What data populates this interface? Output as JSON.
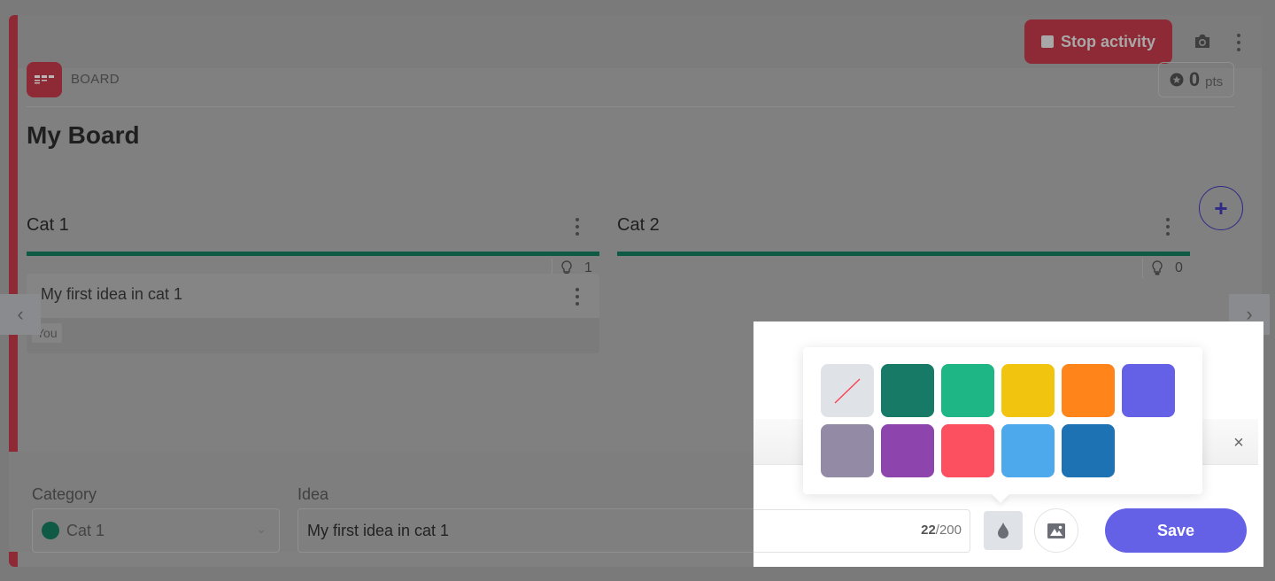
{
  "header": {
    "stop_label": "Stop activity",
    "points_value": "0",
    "points_unit": "pts"
  },
  "board": {
    "type_label": "BOARD",
    "title": "My Board"
  },
  "columns": [
    {
      "title": "Cat 1",
      "count": "1",
      "color": "#0f5a44"
    },
    {
      "title": "Cat 2",
      "count": "0",
      "color": "#0f5a44"
    }
  ],
  "ideas": [
    {
      "text": "My first idea in cat 1",
      "author": "You"
    }
  ],
  "form": {
    "category_label": "Category",
    "category_value": "Cat 1",
    "category_color": "#0f5a44",
    "idea_label": "Idea",
    "idea_value": "My first idea in cat 1",
    "char_count": "22",
    "char_max": "/200",
    "save_label": "Save",
    "close_symbol": "×"
  },
  "palette": {
    "colors": [
      "none",
      "#177a66",
      "#1db684",
      "#f1c40f",
      "#ff851b",
      "#6561e6",
      "#938aa5",
      "#8e44ad",
      "#fc5060",
      "#4ea8ec",
      "#1c72b2"
    ]
  },
  "icons": {
    "chevron_left": "‹",
    "chevron_right": "›",
    "chevron_down": "⌄",
    "plus": "+"
  }
}
